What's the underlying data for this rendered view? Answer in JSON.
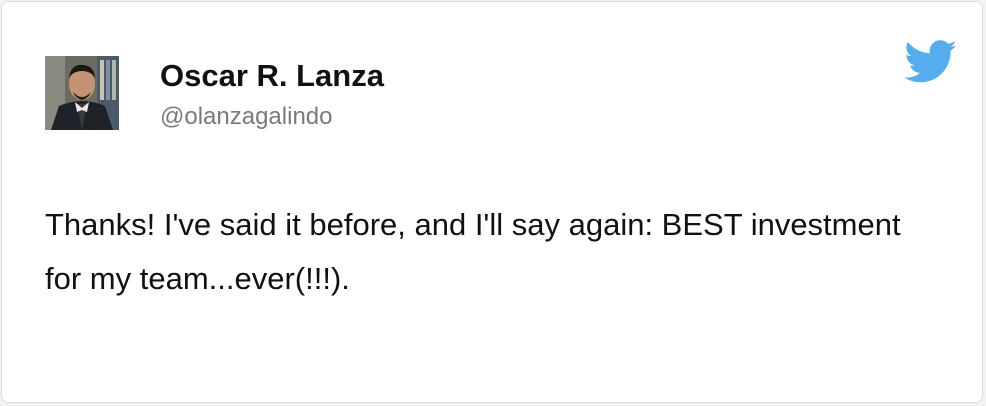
{
  "tweet": {
    "author_name": "Oscar R. Lanza",
    "author_handle": "@olanzagalindo",
    "text": "Thanks! I've said it before, and I'll say again: BEST investment for my team...ever(!!!).",
    "avatar_icon": "person-photo-icon",
    "brand_icon": "twitter-bird-icon",
    "brand_color": "#55acee"
  }
}
